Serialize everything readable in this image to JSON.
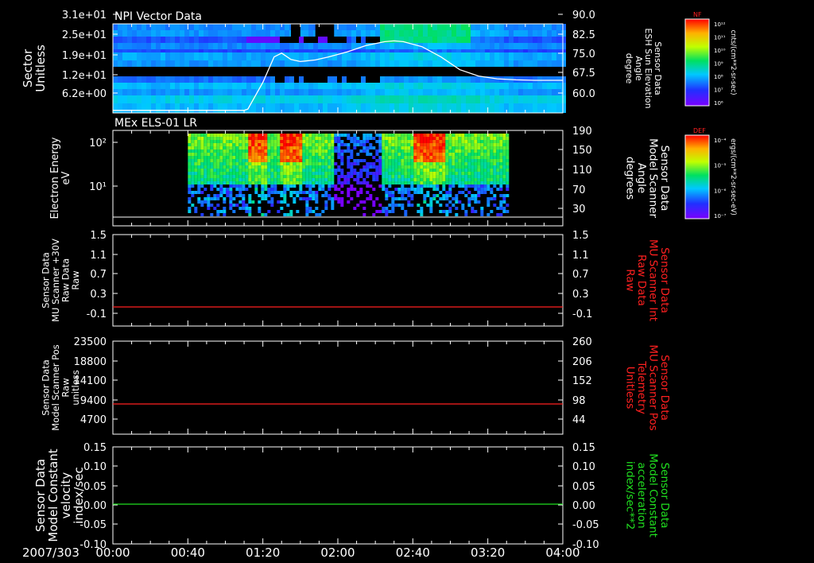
{
  "date_label": "2007/303",
  "time_ticks": [
    "00:00",
    "00:40",
    "01:20",
    "02:00",
    "02:40",
    "03:20",
    "04:00"
  ],
  "colors": {
    "background": "#000000",
    "axis": "#ffffff",
    "red_trace": "#ff2020",
    "green_trace": "#20e020",
    "colorbar_label": "#ff2020"
  },
  "colorbars": [
    {
      "header": "NF",
      "units": "cnts/(cm**2-sr-sec)",
      "ticks": [
        "10¹²",
        "10¹¹",
        "10¹⁰",
        "10⁹",
        "10⁸",
        "10⁷",
        "10⁶"
      ]
    },
    {
      "header": "DEF",
      "units": "ergs/(cm**2-sr-sec-eV)",
      "ticks": [
        "10⁻⁴",
        "10⁻⁵",
        "10⁻⁶",
        "10⁻⁷"
      ]
    }
  ],
  "chart_data": [
    {
      "type": "heatmap",
      "title": "NPI Vector Data",
      "ylabel_lines": [
        "Sector",
        "Unitless"
      ],
      "yticks": [
        "3.1e+01",
        "2.5e+01",
        "1.9e+01",
        "1.2e+01",
        "6.2e+00"
      ],
      "right_label_lines": [
        "Sensor Data",
        "ESH Sun Elevation",
        "Angle",
        "degree"
      ],
      "right_ticks": [
        "90.0",
        "82.5",
        "75.0",
        "67.5",
        "60.0"
      ],
      "right_ylim": [
        55,
        90
      ],
      "overlay_series": {
        "name": "ESH Sun Elevation Angle",
        "x": [
          "00:00",
          "01:10",
          "01:12",
          "01:20",
          "01:26",
          "01:30",
          "01:35",
          "01:40",
          "01:48",
          "01:55",
          "02:05",
          "02:15",
          "02:25",
          "02:30",
          "02:35",
          "02:45",
          "02:55",
          "03:05",
          "03:15",
          "03:25",
          "03:35",
          "03:45",
          "04:00"
        ],
        "y": [
          56,
          56,
          56.5,
          67,
          77,
          78.5,
          76,
          75.2,
          75.8,
          77,
          79,
          81.5,
          83,
          83.3,
          83,
          81,
          77,
          72,
          69.5,
          68.4,
          68,
          67.8,
          67.8
        ]
      }
    },
    {
      "type": "heatmap",
      "title": "MEx ELS-01 LR",
      "ylabel_lines": [
        "Electron Energy",
        "eV"
      ],
      "yticks": [
        "10²",
        "10¹"
      ],
      "right_label_lines": [
        "Sensor Data",
        "Model Scanner",
        "Angle",
        "degrees"
      ],
      "right_ticks": [
        "190",
        "150",
        "110",
        "70",
        "30"
      ],
      "right_ylim": [
        0,
        190
      ],
      "overlay_series": {
        "name": "Model Scanner Angle",
        "x": [
          "00:00",
          "04:00"
        ],
        "y": [
          2,
          2
        ]
      }
    },
    {
      "type": "line",
      "ylabel_lines": [
        "Sensor Data",
        "MU Scanner +30V",
        "Raw Data",
        "Raw"
      ],
      "yticks": [
        "1.5",
        "1.1",
        "0.7",
        "0.3",
        "-0.1"
      ],
      "ylim": [
        -0.3,
        1.5
      ],
      "right_label_lines": [
        "Sensor Data",
        "MU Scanner Int",
        "Raw Data",
        "Raw"
      ],
      "right_ticks": [
        "1.5",
        "1.1",
        "0.7",
        "0.3",
        "-0.1"
      ],
      "series": [
        {
          "name": "MU Scanner Int Raw",
          "x": [
            "00:00",
            "04:00"
          ],
          "values": [
            0.0,
            0.0
          ]
        }
      ]
    },
    {
      "type": "line",
      "ylabel_lines": [
        "Sensor Data",
        "Model Scanner Pos",
        "Raw",
        "unitless"
      ],
      "yticks": [
        "23500",
        "18800",
        "14100",
        "9400",
        "4700"
      ],
      "ylim": [
        0,
        23500
      ],
      "right_label_lines": [
        "Sensor Data",
        "MU Scanner Pos",
        "Telemetry",
        "Unitless"
      ],
      "right_ticks": [
        "260",
        "206",
        "152",
        "98",
        "44"
      ],
      "series": [
        {
          "name": "MU Scanner Pos Telemetry",
          "x": [
            "00:00",
            "04:00"
          ],
          "values": [
            8000,
            8000
          ]
        }
      ]
    },
    {
      "type": "line",
      "ylabel_lines": [
        "Sensor Data",
        "Model Constant",
        "velocity",
        "index/sec"
      ],
      "yticks": [
        "0.15",
        "0.10",
        "0.05",
        "0.00",
        "-0.05",
        "-0.10"
      ],
      "ylim": [
        -0.1,
        0.15
      ],
      "right_label_lines": [
        "Sensor Data",
        "Model Constant",
        "acceleration",
        "index/sec**2"
      ],
      "right_ticks": [
        "0.15",
        "0.10",
        "0.05",
        "0.00",
        "-0.05",
        "-0.10"
      ],
      "series": [
        {
          "name": "Model Constant acceleration",
          "x": [
            "00:00",
            "04:00"
          ],
          "values": [
            0.0,
            0.0
          ]
        }
      ]
    }
  ]
}
